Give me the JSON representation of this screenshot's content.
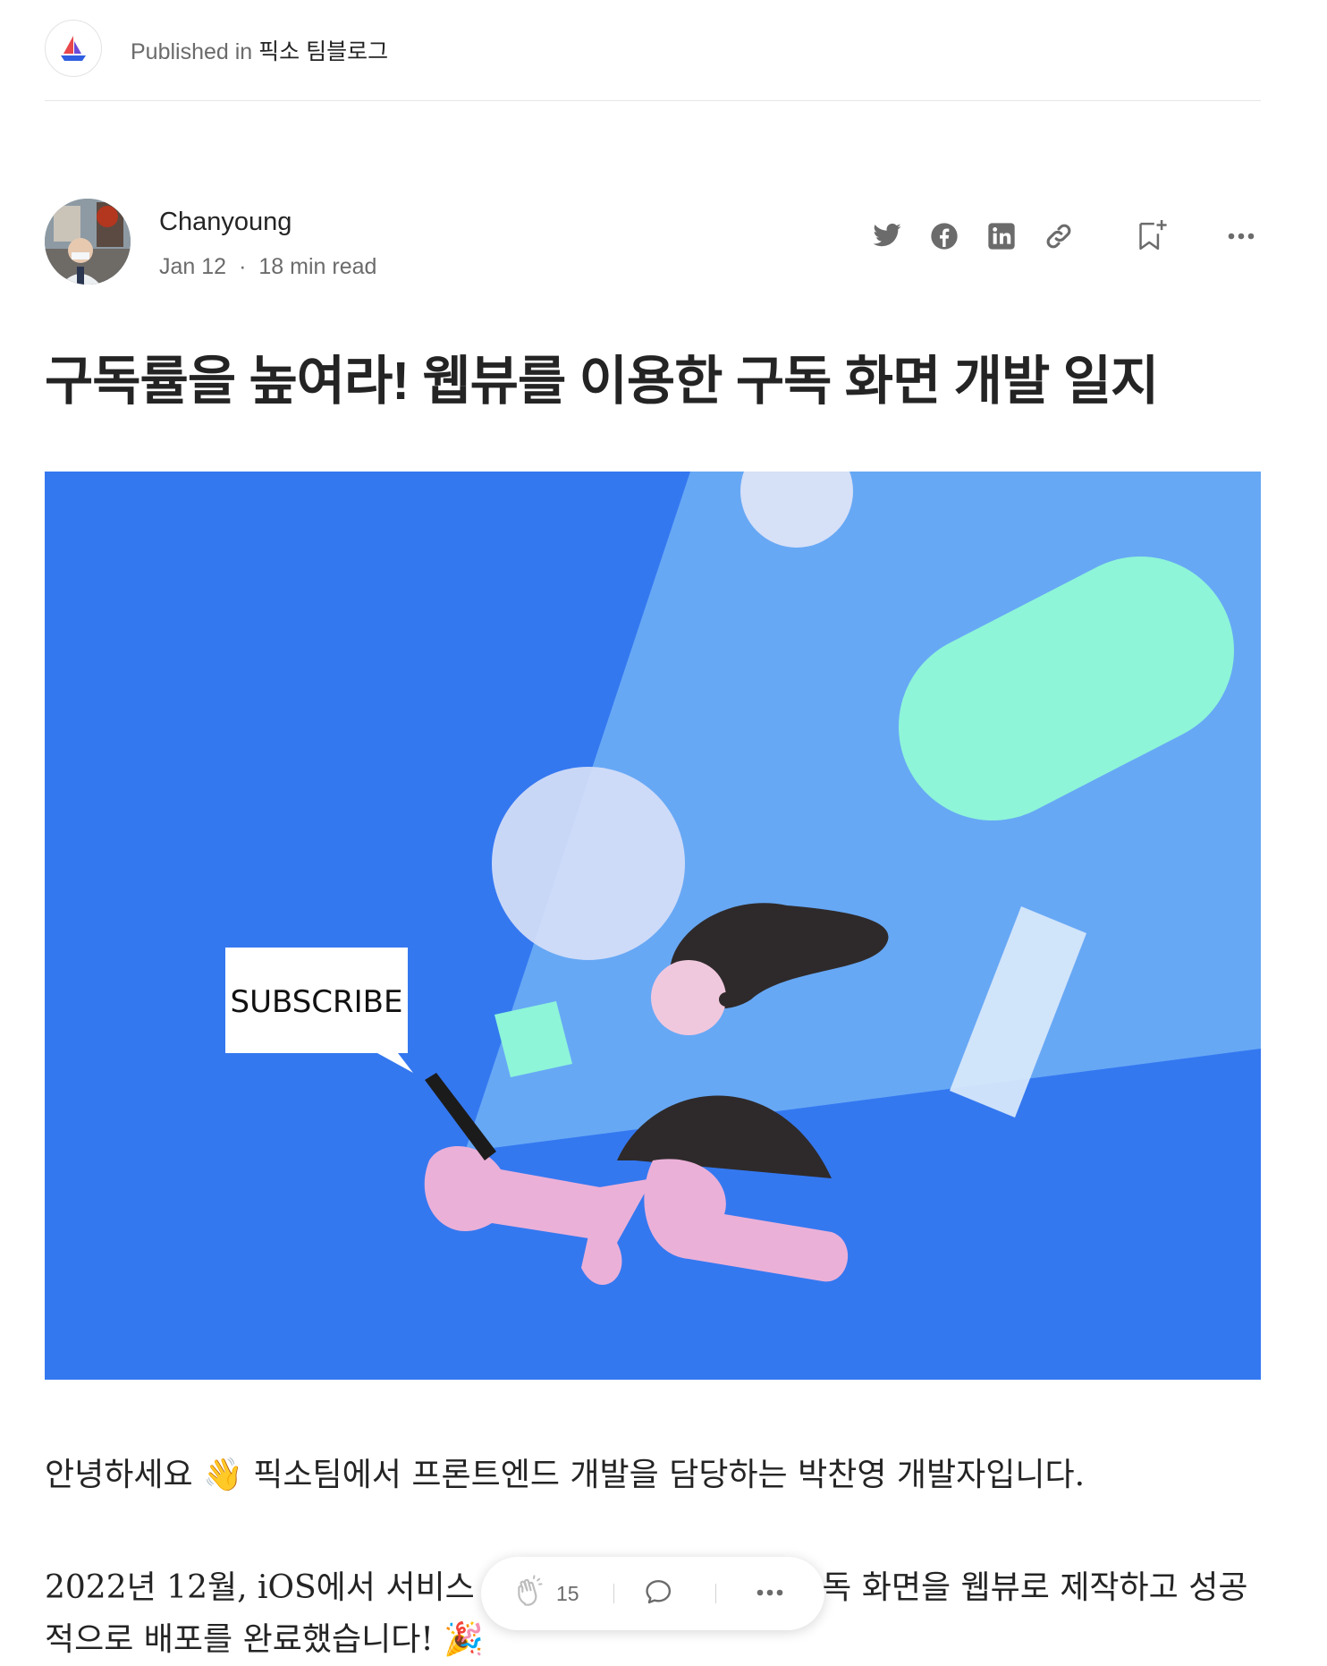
{
  "publication": {
    "prefix": "Published in",
    "name": "픽소 팀블로그",
    "logo_icon": "sailboat-icon"
  },
  "author": {
    "name": "Chanyoung",
    "date": "Jan 12",
    "separator": "·",
    "read_time": "18 min read",
    "avatar_icon": "author-avatar"
  },
  "share_actions": [
    "twitter-icon",
    "facebook-icon",
    "linkedin-icon",
    "link-icon",
    "bookmark-add-icon",
    "more-icon"
  ],
  "article": {
    "title": "구독률을 높여라! 웹뷰를 이용한 구독 화면 개발 일지",
    "hero": {
      "sign_text": "SUBSCRIBE",
      "colors": {
        "background": "#3478F0",
        "beam": "#67A8F5",
        "mint": "#8EF5D8",
        "pale": "#D6E0F7",
        "skin": "#F0C8DE",
        "arm": "#EBB0D8",
        "hair": "#2E2A2B"
      }
    },
    "paragraphs": [
      "안녕하세요 👋 픽소팀에서 프론트엔드 개발을 담당하는 박찬영 개발자입니다.",
      "2022년 12월, iOS에서 서비스 하고 있는 앱에 들어갈 구독 화면을 웹뷰로 제작하고 성공적으로 배포를 완료했습니다! 🎉"
    ]
  },
  "action_bar": {
    "clap_count": "15",
    "clap_icon": "clap-icon",
    "comment_icon": "comment-icon",
    "more_icon": "more-icon"
  },
  "colors": {
    "text": "#242424",
    "muted": "#6b6b6b",
    "divider": "#e6e6e6"
  }
}
